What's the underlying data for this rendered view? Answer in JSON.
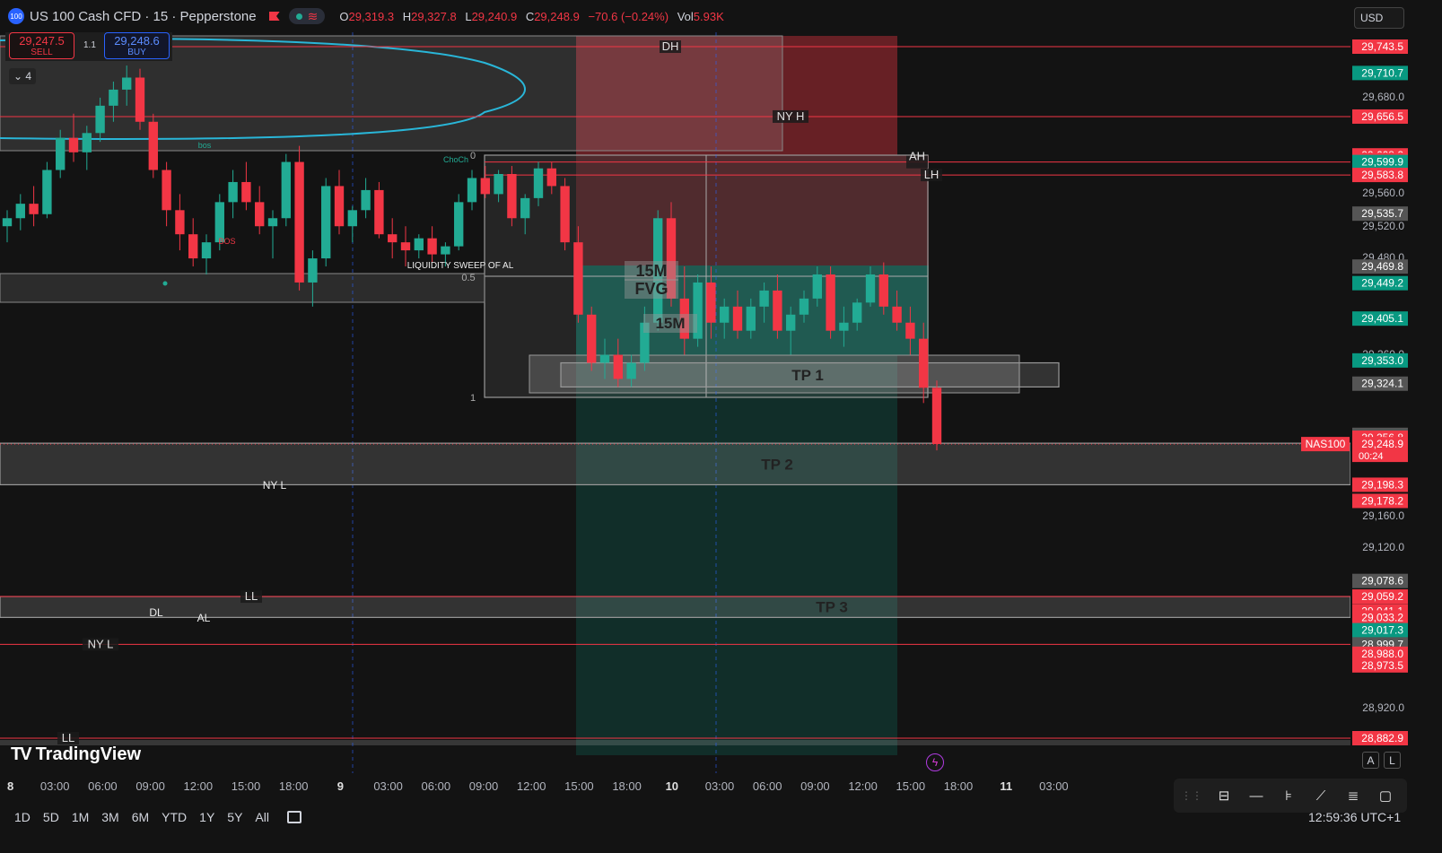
{
  "header": {
    "badge": "100",
    "title": "US 100 Cash CFD · 15 · Pepperstone",
    "ohlc": [
      {
        "k": "O",
        "v": "29,319.3"
      },
      {
        "k": "H",
        "v": "29,327.8"
      },
      {
        "k": "L",
        "v": "29,240.9"
      },
      {
        "k": "C",
        "v": "29,248.9"
      },
      {
        "k": "",
        "v": "−70.6 (−0.24%)"
      },
      {
        "k": "Vol",
        "v": "5.93K"
      }
    ],
    "currency": "USD"
  },
  "trade": {
    "sell_price": "29,247.5",
    "sell_label": "SELL",
    "buy_price": "29,248.6",
    "buy_label": "BUY",
    "spread": "1.1",
    "collapse_count": "4"
  },
  "brand": "TradingView",
  "ranges": [
    "1D",
    "5D",
    "1M",
    "3M",
    "6M",
    "YTD",
    "1Y",
    "5Y",
    "All"
  ],
  "clock": "12:59:36 UTC+1",
  "axis_buttons": {
    "auto": "A",
    "log": "L"
  },
  "colors": {
    "bg": "#131313",
    "up": "#22ab94",
    "down": "#f23645",
    "accent": "#2962ff",
    "profile": "#29b6d8"
  },
  "chart_data": {
    "type": "candlestick",
    "symbol_label": "NAS100",
    "countdown": "00:24",
    "last_price": 29248.9,
    "ylim": [
      28860,
      29760
    ],
    "y_ticks": [
      "29,680.0",
      "29,560.0",
      "29,520.0",
      "29,480.0",
      "29,360.0",
      "29,160.0",
      "29,120.0",
      "28,920.0"
    ],
    "x_ticks": [
      {
        "label": "8",
        "bold": true
      },
      {
        "label": "03:00"
      },
      {
        "label": "06:00"
      },
      {
        "label": "09:00"
      },
      {
        "label": "12:00"
      },
      {
        "label": "15:00"
      },
      {
        "label": "18:00"
      },
      {
        "label": "9",
        "bold": true
      },
      {
        "label": "03:00"
      },
      {
        "label": "06:00"
      },
      {
        "label": "09:00"
      },
      {
        "label": "12:00"
      },
      {
        "label": "15:00"
      },
      {
        "label": "18:00"
      },
      {
        "label": "10",
        "bold": true
      },
      {
        "label": "03:00"
      },
      {
        "label": "06:00"
      },
      {
        "label": "09:00"
      },
      {
        "label": "12:00"
      },
      {
        "label": "15:00"
      },
      {
        "label": "18:00"
      },
      {
        "label": "11",
        "bold": true
      },
      {
        "label": "03:00"
      }
    ],
    "price_labels": [
      {
        "price": 29743.5,
        "text": "29,743.5",
        "color": "#f23645"
      },
      {
        "price": 29710.7,
        "text": "29,710.7",
        "color": "#089981"
      },
      {
        "price": 29656.5,
        "text": "29,656.5",
        "color": "#f23645"
      },
      {
        "price": 29608.2,
        "text": "29,608.2",
        "color": "#f23645"
      },
      {
        "price": 29602.5,
        "text": "29,602.5",
        "color": "#f23645"
      },
      {
        "price": 29599.9,
        "text": "29,599.9",
        "color": "#089981"
      },
      {
        "price": 29583.8,
        "text": "29,583.8",
        "color": "#f23645"
      },
      {
        "price": 29535.7,
        "text": "29,535.7",
        "color": "#555555"
      },
      {
        "price": 29469.8,
        "text": "29,469.8",
        "color": "#555555"
      },
      {
        "price": 29449.2,
        "text": "29,449.2",
        "color": "#089981"
      },
      {
        "price": 29405.1,
        "text": "29,405.1",
        "color": "#089981"
      },
      {
        "price": 29353.0,
        "text": "29,353.0",
        "color": "#089981"
      },
      {
        "price": 29324.1,
        "text": "29,324.1",
        "color": "#555555"
      },
      {
        "price": 29260.4,
        "text": "29,260.4",
        "color": "#555555"
      },
      {
        "price": 29256.8,
        "text": "29,256.8",
        "color": "#f23645"
      },
      {
        "price": 29198.3,
        "text": "29,198.3",
        "color": "#f23645"
      },
      {
        "price": 29178.2,
        "text": "29,178.2",
        "color": "#f23645"
      },
      {
        "price": 29078.6,
        "text": "29,078.6",
        "color": "#555555"
      },
      {
        "price": 29059.2,
        "text": "29,059.2",
        "color": "#f23645"
      },
      {
        "price": 29041.1,
        "text": "29,041.1",
        "color": "#f23645"
      },
      {
        "price": 29033.2,
        "text": "29,033.2",
        "color": "#f23645"
      },
      {
        "price": 29017.3,
        "text": "29,017.3",
        "color": "#089981"
      },
      {
        "price": 28999.7,
        "text": "28,999.7",
        "color": "#555555"
      },
      {
        "price": 28988.0,
        "text": "28,988.0",
        "color": "#f23645"
      },
      {
        "price": 28973.5,
        "text": "28,973.5",
        "color": "#f23645"
      },
      {
        "price": 28882.9,
        "text": "28,882.9",
        "color": "#f23645"
      }
    ],
    "levels": [
      {
        "price": 29743.5,
        "label": "DH",
        "color": "#f23645"
      },
      {
        "price": 29656.5,
        "label": "NY H",
        "color": "#f23645"
      },
      {
        "price": 29599.9,
        "label": "AH",
        "color": "#f23645"
      },
      {
        "price": 29583.8,
        "label": "LH",
        "color": "#f23645"
      },
      {
        "price": 29059.2,
        "label": "LL",
        "color": "#f23645"
      },
      {
        "price": 28999.7,
        "label": "NY L",
        "color": "#f23645"
      },
      {
        "price": 28882.9,
        "label": "LL",
        "color": "#f23645"
      }
    ],
    "zones": [
      {
        "label": "TP 1",
        "top": 29350,
        "bottom": 29320
      },
      {
        "label": "TP 2",
        "top": 29250,
        "bottom": 29198.3
      },
      {
        "label": "TP 3",
        "top": 29059.2,
        "bottom": 29033.2
      }
    ],
    "annotations": [
      "15M",
      "FVG",
      "15M",
      "LIQUIDITY SWEEP OF AL",
      "NY L",
      "DL",
      "AL",
      "ChoCh",
      "bos",
      "BOS",
      "0",
      "0.5",
      "1"
    ],
    "candles": [
      [
        29520,
        29540,
        29500,
        29530
      ],
      [
        29530,
        29560,
        29515,
        29548
      ],
      [
        29548,
        29570,
        29520,
        29535
      ],
      [
        29535,
        29600,
        29530,
        29590
      ],
      [
        29590,
        29640,
        29580,
        29630
      ],
      [
        29630,
        29660,
        29600,
        29612
      ],
      [
        29612,
        29645,
        29590,
        29636
      ],
      [
        29636,
        29680,
        29625,
        29670
      ],
      [
        29670,
        29700,
        29650,
        29690
      ],
      [
        29690,
        29720,
        29670,
        29705
      ],
      [
        29705,
        29716,
        29640,
        29650
      ],
      [
        29650,
        29660,
        29580,
        29590
      ],
      [
        29590,
        29600,
        29520,
        29540
      ],
      [
        29540,
        29560,
        29490,
        29510
      ],
      [
        29510,
        29530,
        29470,
        29480
      ],
      [
        29480,
        29510,
        29460,
        29500
      ],
      [
        29500,
        29560,
        29490,
        29550
      ],
      [
        29550,
        29590,
        29530,
        29575
      ],
      [
        29575,
        29600,
        29540,
        29550
      ],
      [
        29550,
        29570,
        29510,
        29520
      ],
      [
        29520,
        29540,
        29480,
        29530
      ],
      [
        29530,
        29610,
        29520,
        29600
      ],
      [
        29600,
        29620,
        29440,
        29450
      ],
      [
        29450,
        29490,
        29420,
        29480
      ],
      [
        29480,
        29580,
        29470,
        29570
      ],
      [
        29570,
        29590,
        29510,
        29520
      ],
      [
        29520,
        29545,
        29500,
        29540
      ],
      [
        29540,
        29580,
        29530,
        29565
      ],
      [
        29565,
        29575,
        29505,
        29510
      ],
      [
        29510,
        29530,
        29480,
        29500
      ],
      [
        29500,
        29520,
        29470,
        29490
      ],
      [
        29490,
        29510,
        29480,
        29505
      ],
      [
        29505,
        29520,
        29475,
        29485
      ],
      [
        29485,
        29500,
        29470,
        29495
      ],
      [
        29495,
        29560,
        29490,
        29550
      ],
      [
        29550,
        29590,
        29540,
        29580
      ],
      [
        29580,
        29595,
        29555,
        29560
      ],
      [
        29560,
        29590,
        29550,
        29585
      ],
      [
        29585,
        29595,
        29520,
        29530
      ],
      [
        29530,
        29560,
        29510,
        29555
      ],
      [
        29555,
        29600,
        29545,
        29592
      ],
      [
        29592,
        29600,
        29560,
        29570
      ],
      [
        29570,
        29580,
        29490,
        29500
      ],
      [
        29500,
        29520,
        29400,
        29410
      ],
      [
        29410,
        29420,
        29340,
        29350
      ],
      [
        29350,
        29380,
        29330,
        29360
      ],
      [
        29360,
        29380,
        29320,
        29330
      ],
      [
        29330,
        29360,
        29320,
        29350
      ],
      [
        29350,
        29420,
        29340,
        29400
      ],
      [
        29400,
        29540,
        29390,
        29530
      ],
      [
        29530,
        29550,
        29420,
        29430
      ],
      [
        29430,
        29470,
        29360,
        29380
      ],
      [
        29380,
        29460,
        29370,
        29450
      ],
      [
        29450,
        29470,
        29380,
        29400
      ],
      [
        29400,
        29430,
        29380,
        29420
      ],
      [
        29420,
        29440,
        29380,
        29390
      ],
      [
        29390,
        29430,
        29380,
        29420
      ],
      [
        29420,
        29450,
        29400,
        29440
      ],
      [
        29440,
        29460,
        29380,
        29390
      ],
      [
        29390,
        29420,
        29360,
        29410
      ],
      [
        29410,
        29440,
        29400,
        29430
      ],
      [
        29430,
        29470,
        29420,
        29460
      ],
      [
        29460,
        29470,
        29380,
        29390
      ],
      [
        29390,
        29420,
        29370,
        29400
      ],
      [
        29400,
        29430,
        29390,
        29425
      ],
      [
        29425,
        29470,
        29420,
        29460
      ],
      [
        29460,
        29475,
        29410,
        29420
      ],
      [
        29420,
        29440,
        29390,
        29400
      ],
      [
        29400,
        29420,
        29360,
        29380
      ],
      [
        29380,
        29400,
        29300,
        29319
      ],
      [
        29319,
        29328,
        29241,
        29249
      ]
    ]
  }
}
